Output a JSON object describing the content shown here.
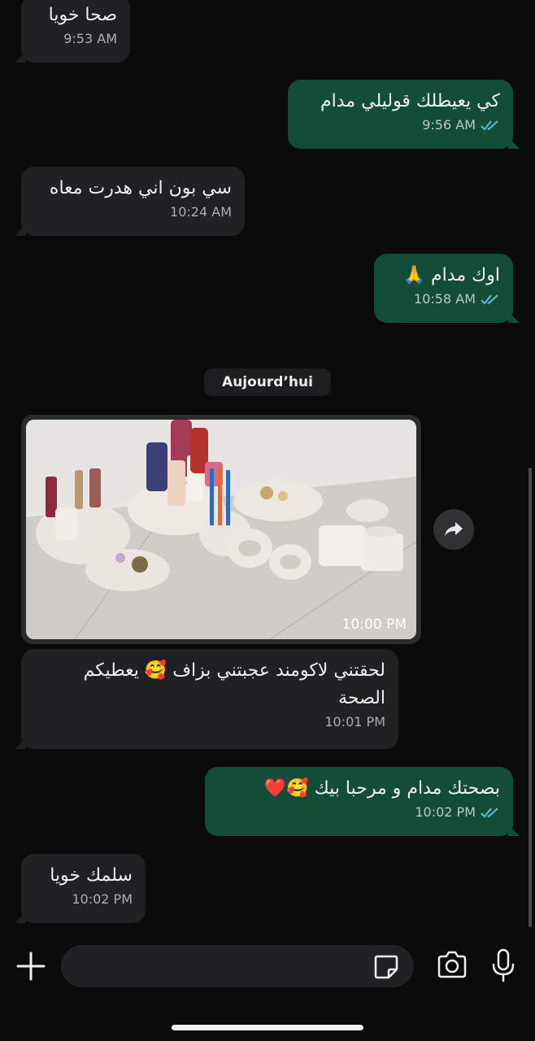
{
  "messages": [
    {
      "dir": "in",
      "text": "صحا خويا",
      "time": "9:53 AM"
    },
    {
      "dir": "out",
      "text": "كي يعيطلك قوليلي مدام",
      "time": "9:56 AM"
    },
    {
      "dir": "in",
      "text": "سي بون اني هدرت معاه",
      "time": "10:24 AM"
    },
    {
      "dir": "out",
      "text": "اوك مدام 🙏",
      "time": "10:58 AM"
    },
    {
      "dir": "in",
      "text": "لحقتني لاكومند عجبتني بزاف 🥰 يعطيكم الصحة",
      "time": "10:01 PM"
    },
    {
      "dir": "out",
      "text": "بصحتك مدام و مرحبا بيك 🥰❤️",
      "time": "10:02 PM"
    },
    {
      "dir": "in",
      "text": "سلمك خويا",
      "time": "10:02 PM"
    }
  ],
  "date_separator": "Aujourd’hui",
  "image_message": {
    "time": "10:00 PM"
  },
  "composer": {
    "placeholder": ""
  },
  "icons": {
    "read_ticks": "double-check-icon",
    "forward": "forward-arrow-icon",
    "attach": "plus-icon",
    "sticker": "sticker-icon",
    "camera": "camera-icon",
    "mic": "microphone-icon"
  },
  "colors": {
    "background": "#0b0b0b",
    "incoming_bubble": "#1f2122",
    "outgoing_bubble": "#144d37",
    "read_tick": "#53bdeb"
  }
}
